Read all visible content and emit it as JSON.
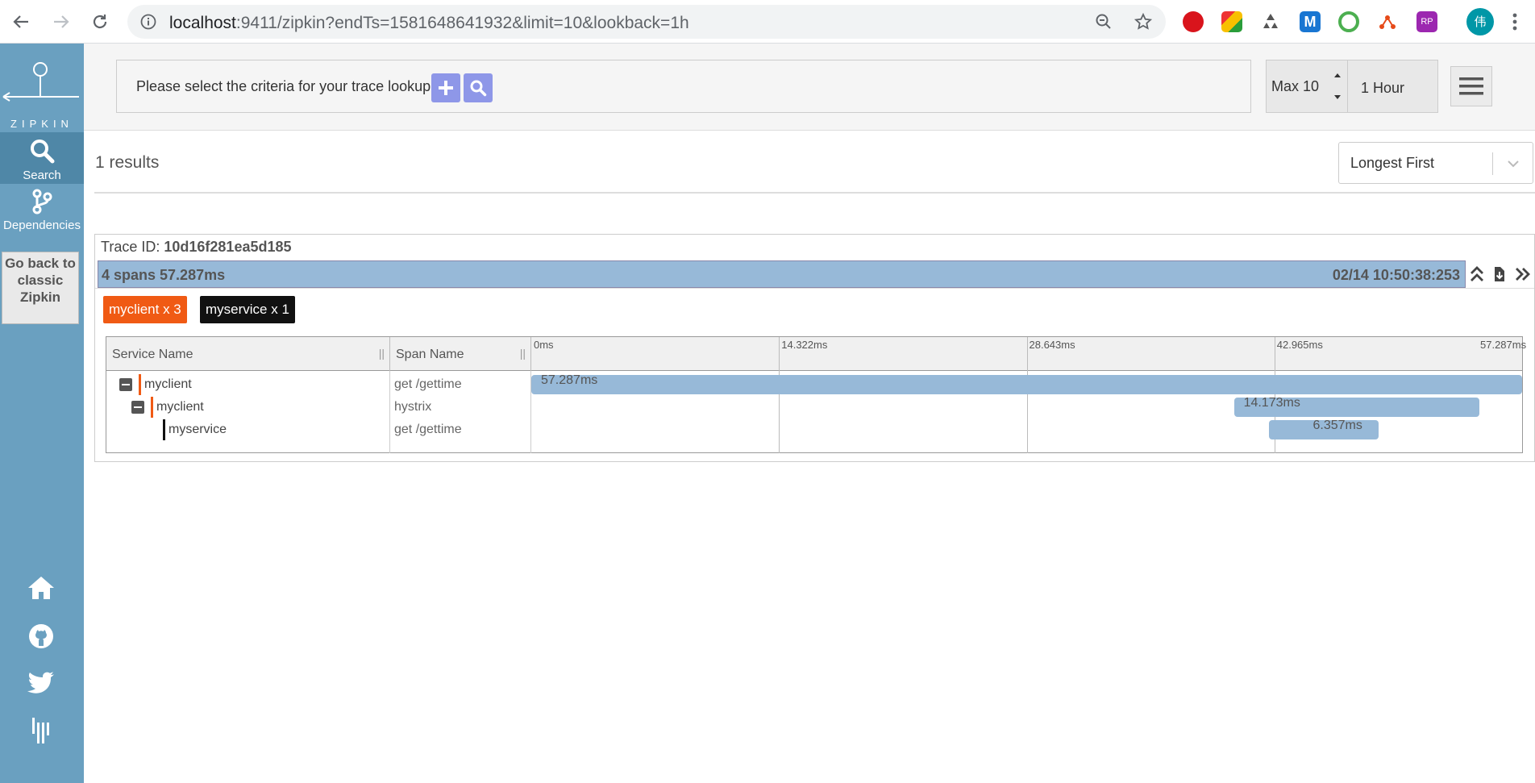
{
  "browser": {
    "url_host": "localhost",
    "url_rest": ":9411/zipkin?endTs=1581648641932&limit=10&lookback=1h",
    "avatar_text": "伟"
  },
  "sidebar": {
    "logo_text": "ZIPKIN",
    "search_label": "Search",
    "dependencies_label": "Dependencies",
    "classic_button": "Go back to classic Zipkin"
  },
  "topbar": {
    "criteria_text": "Please select the criteria for your trace lookup.",
    "limit": "Max 10",
    "lookback": "1 Hour"
  },
  "results": {
    "count": "1 results",
    "sort": "Longest First"
  },
  "trace": {
    "id_label": "Trace ID:",
    "id": "10d16f281ea5d185",
    "summary": "4 spans 57.287ms",
    "timestamp": "02/14 10:50:38:253",
    "badges": [
      {
        "label": "myclient x 3",
        "color": "#f05a14"
      },
      {
        "label": "myservice x 1",
        "color": "#111111"
      }
    ],
    "columns": {
      "service": "Service Name",
      "span": "Span Name"
    },
    "ticks": [
      "0ms",
      "14.322ms",
      "28.643ms",
      "42.965ms",
      "57.287ms"
    ],
    "total_ms": 57.287,
    "spans": [
      {
        "service": "myclient",
        "span": "get /gettime",
        "duration": "57.287ms",
        "start_ms": 0,
        "duration_ms": 57.287,
        "color": "#f05a14",
        "depth": 0,
        "toggle": true
      },
      {
        "service": "myclient",
        "span": "hystrix",
        "duration": "14.173ms",
        "start_ms": 40.626,
        "duration_ms": 14.173,
        "color": "#f05a14",
        "depth": 1,
        "toggle": true
      },
      {
        "service": "myservice",
        "span": "get /gettime",
        "duration": "6.357ms",
        "start_ms": 42.655,
        "duration_ms": 6.357,
        "color": "#111111",
        "depth": 2,
        "toggle": false
      }
    ]
  }
}
